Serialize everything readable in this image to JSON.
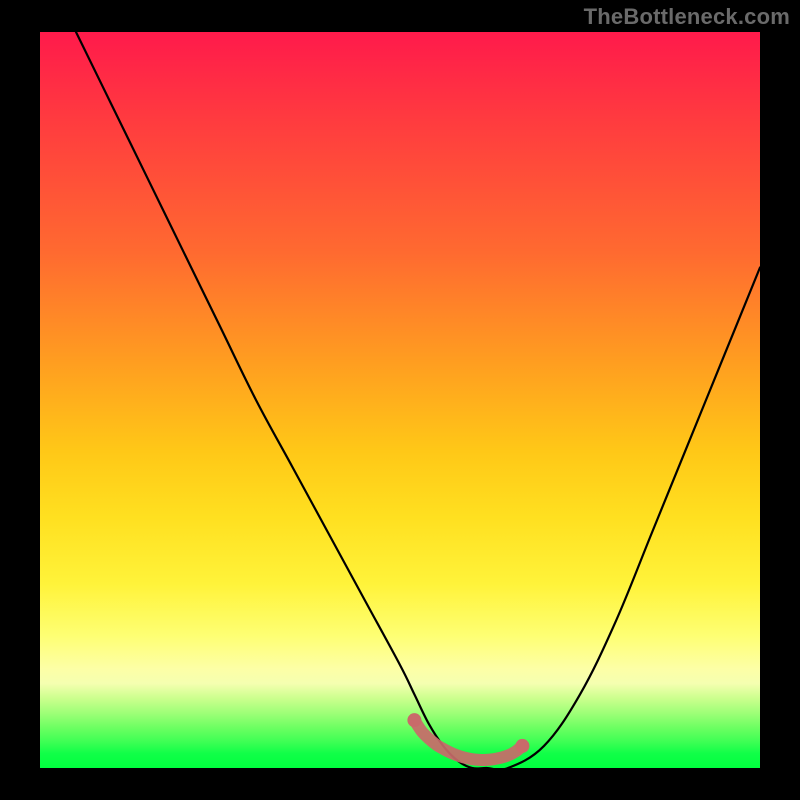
{
  "watermark": "TheBottleneck.com",
  "chart_data": {
    "type": "line",
    "title": "",
    "xlabel": "",
    "ylabel": "",
    "xlim": [
      0,
      100
    ],
    "ylim": [
      0,
      100
    ],
    "grid": false,
    "series": [
      {
        "name": "bottleneck-curve",
        "color": "#000000",
        "x": [
          5,
          10,
          15,
          20,
          25,
          30,
          35,
          40,
          45,
          50,
          52,
          54,
          56,
          58,
          60,
          62,
          65,
          70,
          75,
          80,
          85,
          90,
          95,
          100
        ],
        "y": [
          100,
          90,
          80,
          70,
          60,
          50,
          41,
          32,
          23,
          14,
          10,
          6,
          3,
          1,
          0,
          0,
          0,
          3,
          10,
          20,
          32,
          44,
          56,
          68
        ]
      },
      {
        "name": "marker-band",
        "color": "#d46a6a",
        "x": [
          52,
          53,
          54,
          55,
          56,
          57,
          58,
          59,
          60,
          61,
          62,
          63,
          64,
          65,
          66,
          67
        ],
        "y": [
          6.5,
          5.0,
          4.0,
          3.2,
          2.6,
          2.1,
          1.7,
          1.4,
          1.2,
          1.1,
          1.1,
          1.2,
          1.4,
          1.7,
          2.2,
          3.0
        ]
      }
    ],
    "gradient_stops": [
      {
        "pos": 0.0,
        "color": "#ff1a4b"
      },
      {
        "pos": 0.12,
        "color": "#ff3b3f"
      },
      {
        "pos": 0.3,
        "color": "#ff6a30"
      },
      {
        "pos": 0.45,
        "color": "#ff9e20"
      },
      {
        "pos": 0.57,
        "color": "#ffc817"
      },
      {
        "pos": 0.66,
        "color": "#ffe020"
      },
      {
        "pos": 0.75,
        "color": "#fff33a"
      },
      {
        "pos": 0.82,
        "color": "#feff73"
      },
      {
        "pos": 0.87,
        "color": "#fdffa6"
      },
      {
        "pos": 0.9,
        "color": "#ccff8e"
      },
      {
        "pos": 0.94,
        "color": "#6dff62"
      },
      {
        "pos": 1.0,
        "color": "#00ff3e"
      }
    ]
  }
}
